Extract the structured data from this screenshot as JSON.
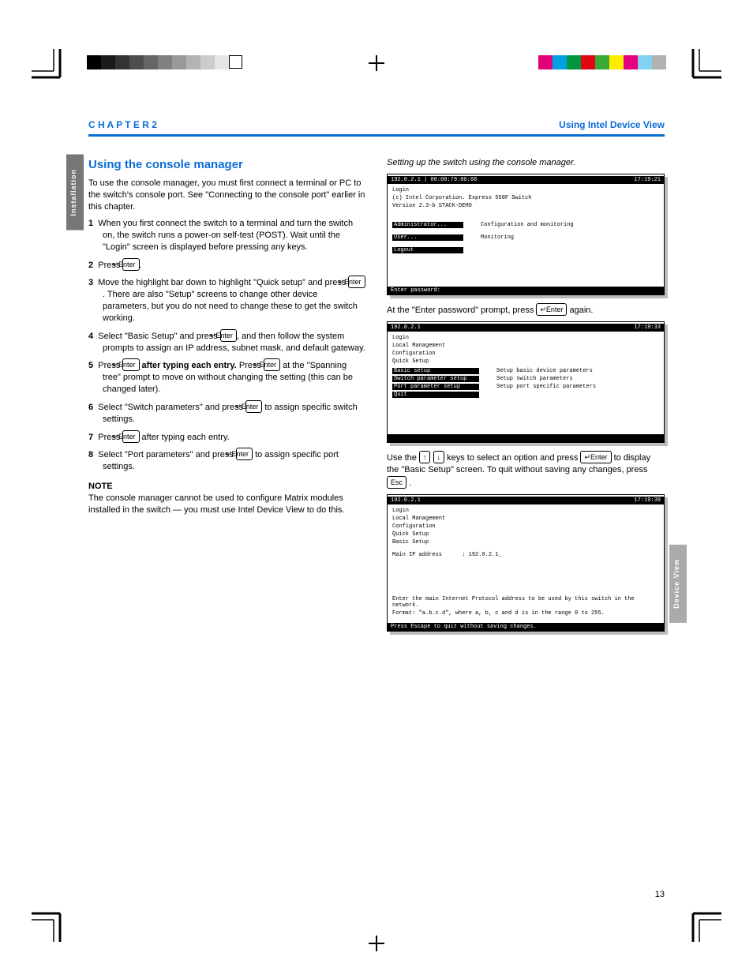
{
  "reg": {
    "grays": [
      "#000000",
      "#1a1a1a",
      "#333333",
      "#4d4d4d",
      "#666666",
      "#808080",
      "#999999",
      "#b3b3b3",
      "#cccccc",
      "#e6e6e6",
      "#ffffff"
    ],
    "colors": [
      "#e20079",
      "#00a0e3",
      "#009640",
      "#e30613",
      "#3aaa35",
      "#ffed00",
      "#e6007e",
      "#83d0f5",
      "#b2b2b2"
    ]
  },
  "header": {
    "left_chapter": "C H A P T E R  2",
    "right_title": "Using Intel Device View"
  },
  "tabs": {
    "left": "Installation",
    "right": "Device View"
  },
  "left": {
    "h2": "Using the console manager",
    "intro": "To use the console manager, you must first connect a terminal or PC to the switch's console port. See \"Connecting to the console port\" earlier in this chapter.",
    "steps": [
      {
        "n": "1",
        "text": "When you first connect the switch to a terminal and turn the switch on, the switch runs a power-on self-test (POST). Wait until the \"Login\" screen is displayed before pressing any keys."
      },
      {
        "n": "2",
        "before": "Press ",
        "key": "↵Enter",
        "after": "."
      },
      {
        "n": "3",
        "before": "Move the highlight bar down to highlight \"Quick setup\" and press ",
        "key": "↵Enter",
        "after": ". There are also \"Setup\" screens to change other device parameters, but you do not need to change these to get the switch working."
      },
      {
        "n": "4",
        "before": "Select \"Basic Setup\" and press ",
        "key": "↵Enter",
        "after": ", and then follow the system prompts to assign an IP address, subnet mask, and default gateway."
      },
      {
        "n": "5",
        "before": "Press ",
        "key": "↵Enter",
        "after_bold": " after typing each entry.",
        "after": " Press ",
        "key2": "↵Enter",
        "after2": " at the \"Spanning tree\" prompt to move on without changing the setting (this can be changed later)."
      },
      {
        "n": "6",
        "before": "Select \"Switch parameters\" and press ",
        "key": "↵Enter",
        "after": " to assign specific switch settings."
      },
      {
        "n": "7",
        "before": "Press ",
        "key": "↵Enter",
        "after": " after typing each entry."
      },
      {
        "n": "8",
        "before": "Select \"Port parameters\" and press ",
        "key": "↵Enter",
        "after": " to assign specific port settings."
      }
    ],
    "note_label": "NOTE",
    "note_text": "The console manager cannot be used to configure Matrix modules installed in the switch — you must use Intel Device View to do this."
  },
  "right": {
    "heading": "Setting up the switch using the console manager.",
    "seq_a_before": "At the \"Enter password\" prompt, press ",
    "seq_a_key": "↵Enter",
    "seq_a_after": " again.",
    "seq_b_before": "Use the ",
    "seq_b_keys": [
      "↑",
      "↓"
    ],
    "seq_b_mid": " keys to select an option and press ",
    "seq_b_key": "↵Enter",
    "seq_b_after": " to display the \"Basic Setup\" screen. To quit without saving any changes, press ",
    "seq_b_esc": "Esc",
    "seq_b_end": "."
  },
  "shot1": {
    "ip": "192.0.2.1",
    "mac": "00:00:79:00:68",
    "time": "17:19:21",
    "line1": "Login",
    "line2": "(c) Intel Corporation. Express 550F Switch",
    "line3": "Version 2.3-b  STACK-DEMO",
    "opt1": "Administrator...",
    "opt1d": "Configuration and monitoring",
    "opt2": "User...",
    "opt2d": "Monitoring",
    "opt3": "Logout",
    "status": "Enter password:"
  },
  "shot2": {
    "ip": "192.0.2.1",
    "time": "17:19:33",
    "crumb1": "Login",
    "crumb2": "Local Management",
    "crumb3": "Configuration",
    "crumb4": "Quick Setup",
    "opt1": "Basic setup",
    "opt1d": "Setup basic device parameters",
    "opt2": "Switch parameter setup",
    "opt2d": "Setup switch parameters",
    "opt3": "Port parameter setup",
    "opt3d": "Setup port specific parameters",
    "opt4": "Quit",
    "status": ""
  },
  "shot3": {
    "ip": "192.0.2.1",
    "time": "17:19:39",
    "crumb1": "Login",
    "crumb2": "Local Management",
    "crumb3": "Configuration",
    "crumb4": "Quick Setup",
    "crumb5": "Basic Setup",
    "field": "Main IP address",
    "value": ": 192.0.2.1_",
    "help1": "Enter the main Internet Protocol address to be used by this switch in the network.",
    "help2": "Format: \"a.b.c.d\", where a, b, c and d is in the range 0 to 255.",
    "status": "Press Escape to quit without saving changes."
  },
  "page_number": "13"
}
